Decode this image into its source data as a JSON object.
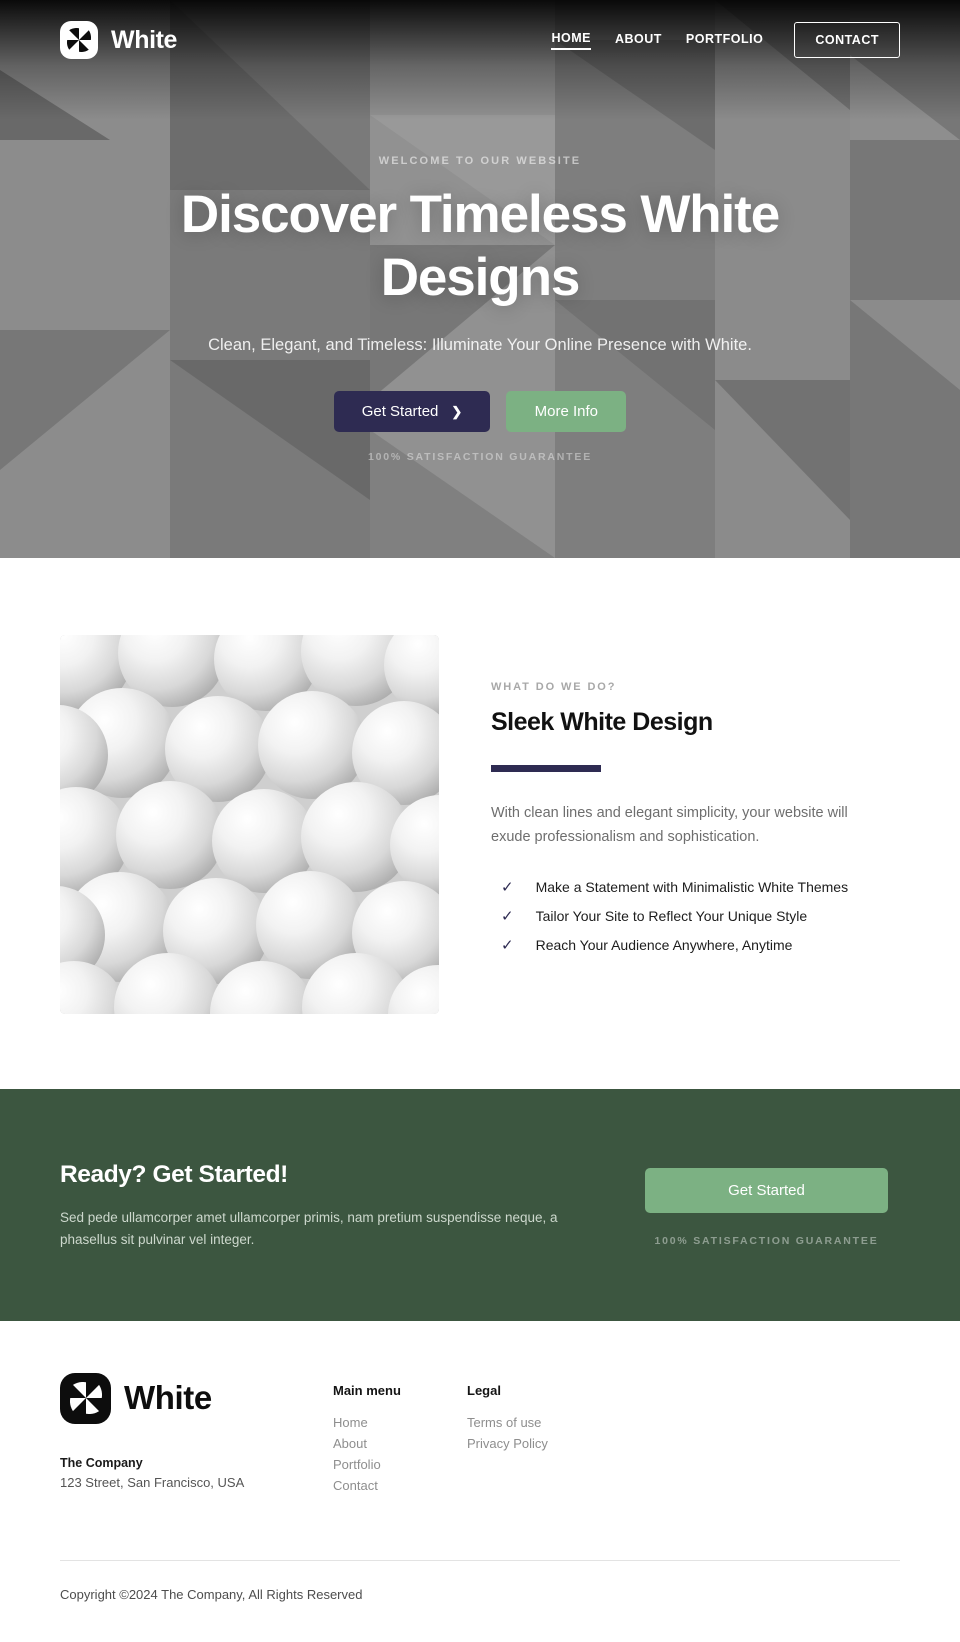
{
  "header": {
    "brand": "White",
    "logo_icon": "pinwheel-logo-icon",
    "nav": [
      {
        "label": "HOME",
        "active": true
      },
      {
        "label": "ABOUT",
        "active": false
      },
      {
        "label": "PORTFOLIO",
        "active": false
      }
    ],
    "cta_label": "CONTACT"
  },
  "hero": {
    "eyebrow": "WELCOME TO OUR WEBSITE",
    "title": "Discover Timeless White Designs",
    "subtitle": "Clean, Elegant, and Timeless: Illuminate Your Online Presence with White.",
    "primary_button": "Get Started",
    "primary_button_icon": "chevron-right-icon",
    "secondary_button": "More Info",
    "guarantee": "100% SATISFACTION GUARANTEE"
  },
  "feature": {
    "image_alt": "white-spheres-photo",
    "kicker": "WHAT DO WE DO?",
    "heading": "Sleek White Design",
    "paragraph": "With clean lines and elegant simplicity, your website will exude professionalism and sophistication.",
    "check_icon": "check-icon",
    "list": [
      "Make a Statement with Minimalistic White Themes",
      "Tailor Your Site to Reflect Your Unique Style",
      "Reach Your Audience Anywhere, Anytime"
    ]
  },
  "cta": {
    "heading": "Ready? Get Started!",
    "paragraph": "Sed pede ullamcorper amet ullamcorper primis, nam pretium suspendisse neque, a phasellus sit pulvinar vel integer.",
    "button": "Get Started",
    "guarantee": "100% SATISFACTION GUARANTEE"
  },
  "footer": {
    "brand": "White",
    "logo_icon": "pinwheel-logo-icon",
    "company": "The Company",
    "address": "123 Street, San Francisco, USA",
    "columns": [
      {
        "title": "Main menu",
        "links": [
          "Home",
          "About",
          "Portfolio",
          "Contact"
        ]
      },
      {
        "title": "Legal",
        "links": [
          "Terms of use",
          "Privacy Policy"
        ]
      }
    ],
    "copyright": "Copyright ©2024 The Company, All Rights Reserved"
  },
  "colors": {
    "navy": "#2e2b52",
    "green": "#7cb183",
    "dark_green": "#3c5640"
  }
}
